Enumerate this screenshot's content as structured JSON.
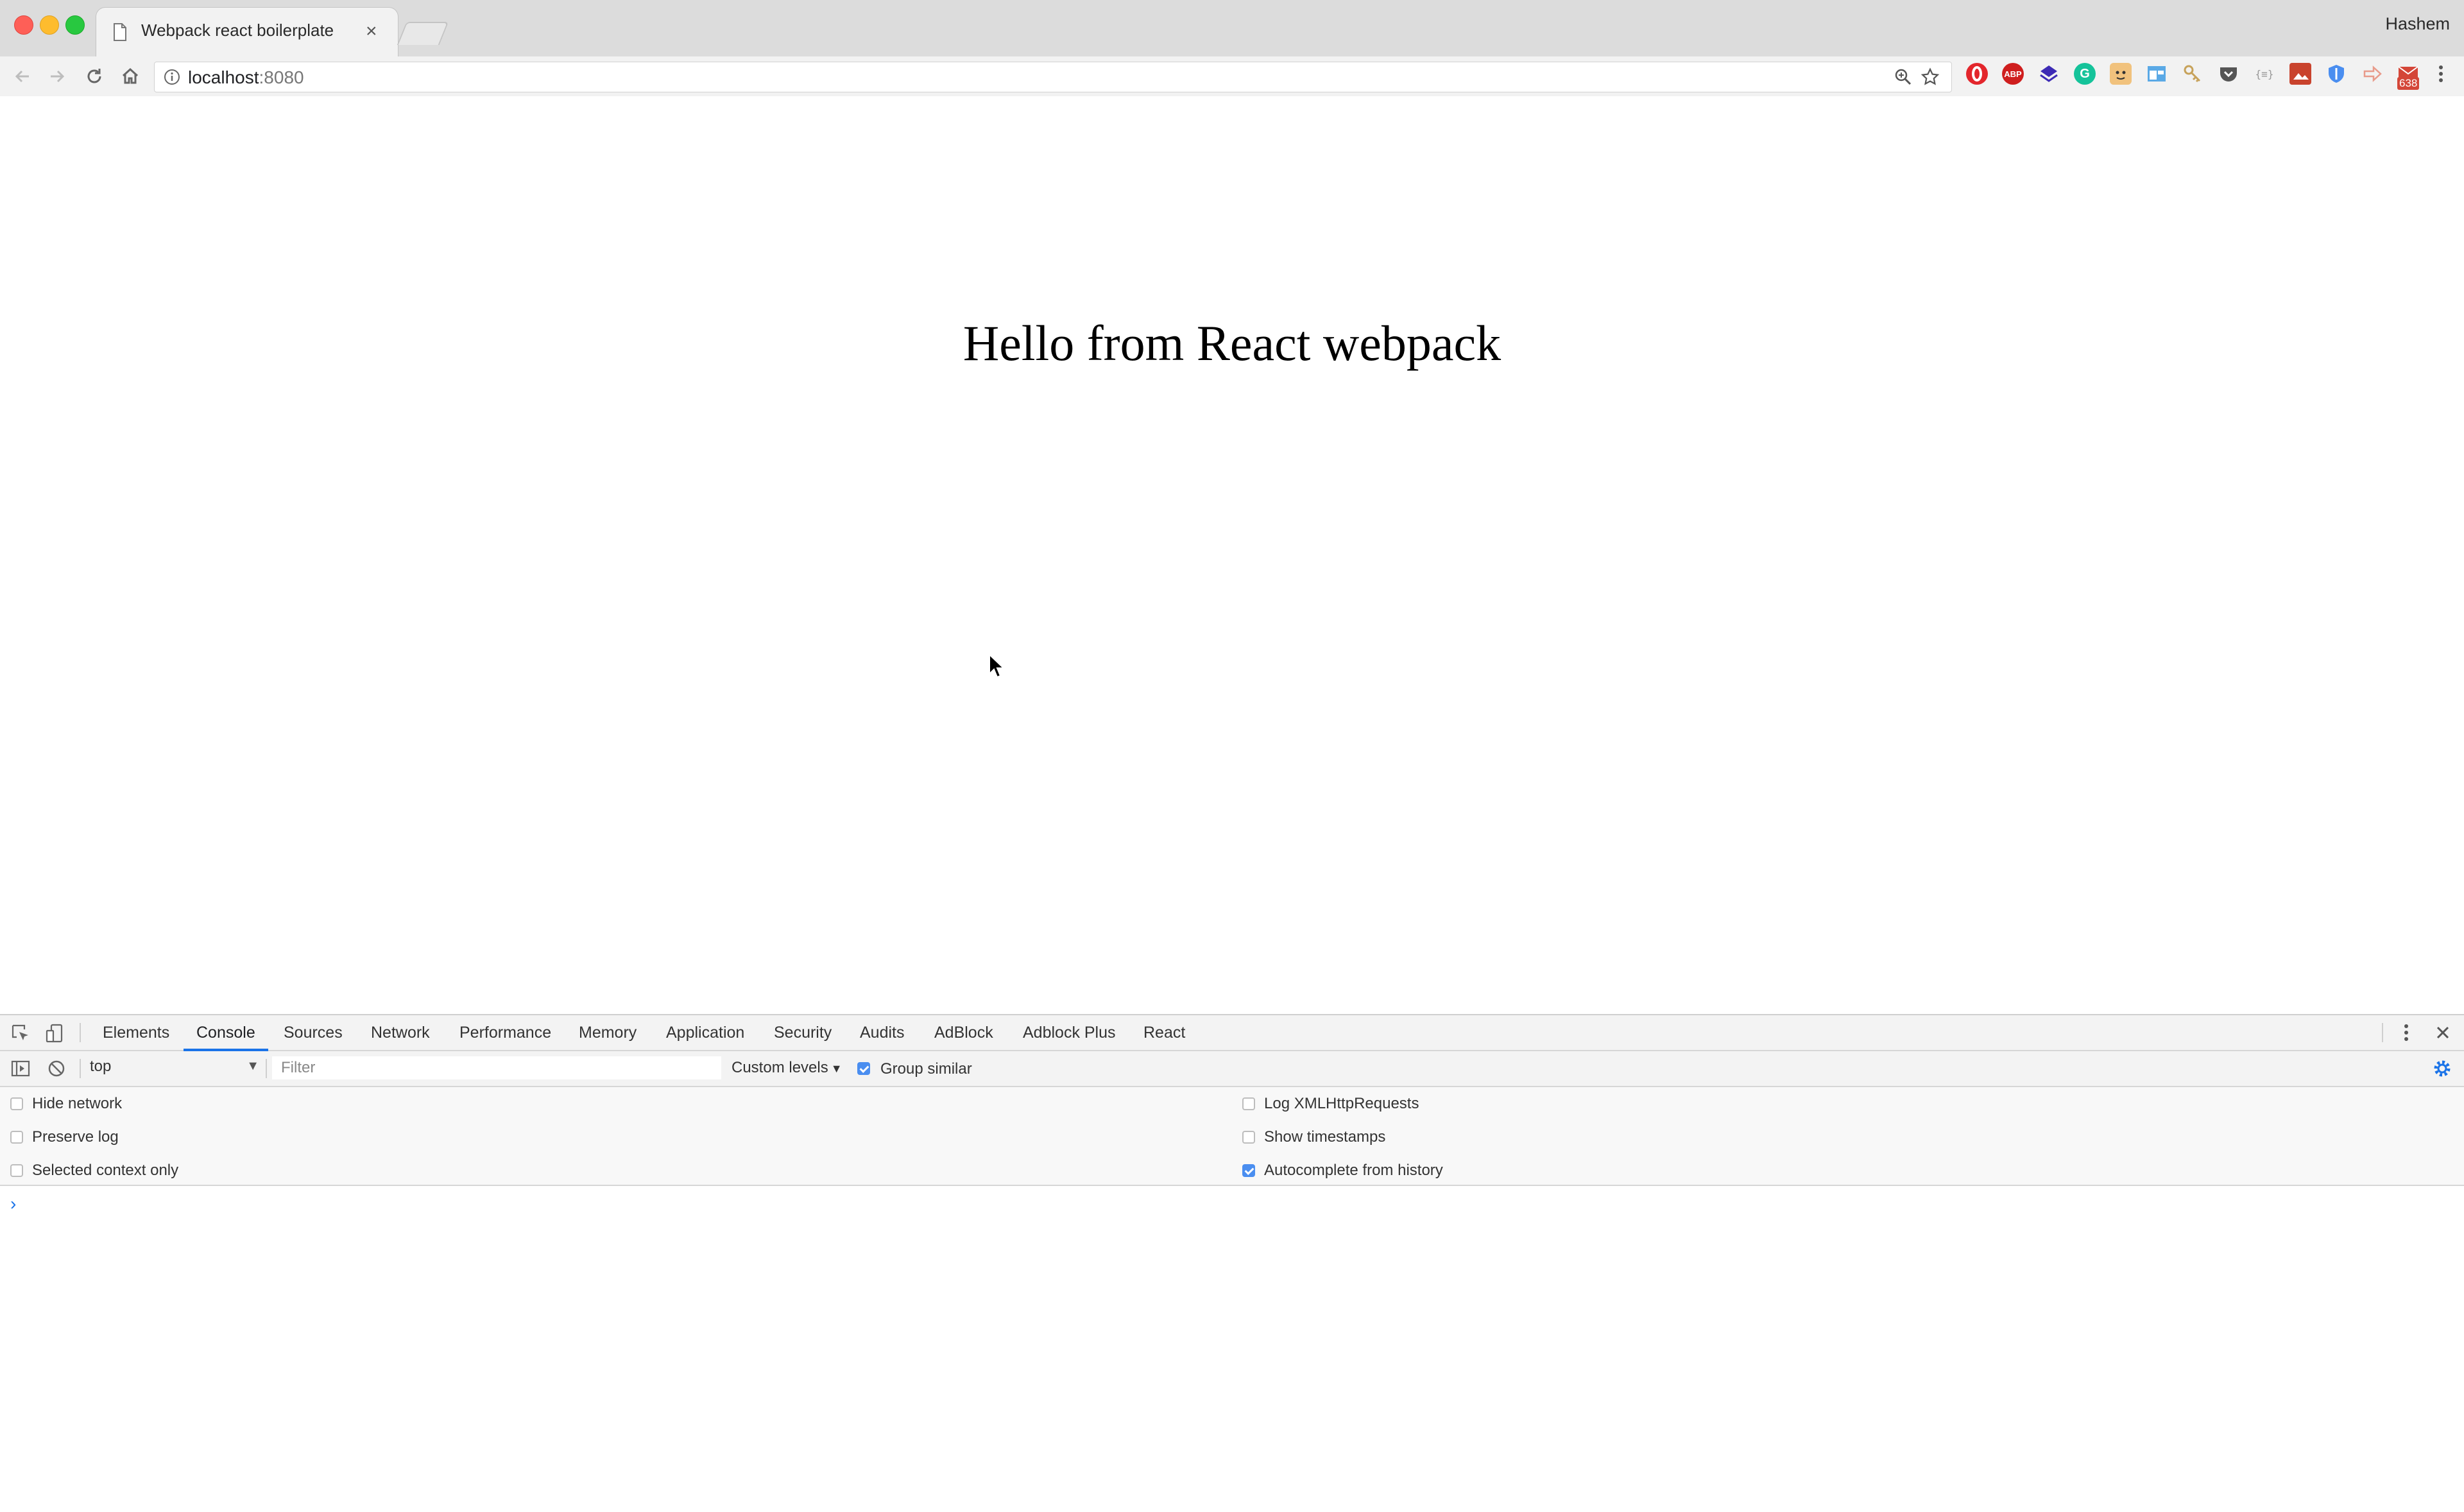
{
  "window": {
    "profile_name": "Hashem",
    "traffic_lights": [
      "close",
      "minimize",
      "maximize"
    ]
  },
  "tab": {
    "title": "Webpack react boilerplate",
    "close_glyph": "×",
    "icon": "page-icon"
  },
  "toolbar": {
    "url_host": "localhost",
    "url_port": ":8080",
    "nav_icons": [
      "back-icon",
      "forward-icon",
      "reload-icon",
      "home-icon"
    ],
    "extension_badge": "638",
    "extensions": [
      "opera-icon",
      "adblock-plus-icon",
      "layers-icon",
      "grammarly-icon",
      "emoji-icon",
      "window-icon",
      "key-icon",
      "pocket-icon",
      "json-icon",
      "gallery-icon",
      "shield-icon",
      "arrow-icon",
      "mail-icon"
    ]
  },
  "page": {
    "heading": "Hello from React webpack"
  },
  "devtools": {
    "tabs": [
      "Elements",
      "Console",
      "Sources",
      "Network",
      "Performance",
      "Memory",
      "Application",
      "Security",
      "Audits",
      "AdBlock",
      "Adblock Plus",
      "React"
    ],
    "active_tab": "Console",
    "console": {
      "context": "top",
      "filter_placeholder": "Filter",
      "levels": "Custom levels",
      "group_similar_label": "Group similar",
      "group_similar_checked": true
    },
    "settings": {
      "left": [
        {
          "label": "Hide network",
          "checked": false
        },
        {
          "label": "Preserve log",
          "checked": false
        },
        {
          "label": "Selected context only",
          "checked": false
        }
      ],
      "right": [
        {
          "label": "Log XMLHttpRequests",
          "checked": false
        },
        {
          "label": "Show timestamps",
          "checked": false
        },
        {
          "label": "Autocomplete from history",
          "checked": true
        }
      ]
    },
    "prompt_glyph": "›"
  },
  "colors": {
    "accent": "#1a73e8",
    "checkbox_on": "#4a8ef0",
    "chrome_bg": "#dcdcdc"
  }
}
